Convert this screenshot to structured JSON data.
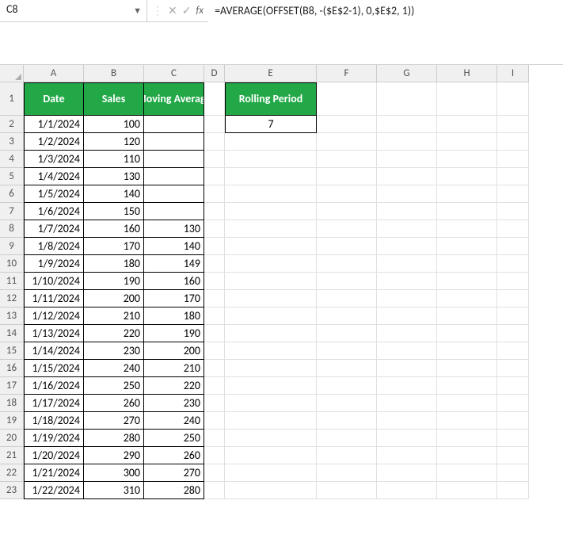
{
  "nameBox": "C8",
  "formula": "=AVERAGE(OFFSET(B8, -($E$2-1), 0,$E$2, 1))",
  "columns": [
    "A",
    "B",
    "C",
    "D",
    "E",
    "F",
    "G",
    "H",
    "I"
  ],
  "headers": {
    "date": "Date",
    "sales": "Sales",
    "mavg": "Moving Average",
    "period": "Rolling Period"
  },
  "periodValue": "7",
  "rows": [
    {
      "n": 2,
      "date": "1/1/2024",
      "sales": "100",
      "mavg": ""
    },
    {
      "n": 3,
      "date": "1/2/2024",
      "sales": "120",
      "mavg": ""
    },
    {
      "n": 4,
      "date": "1/3/2024",
      "sales": "110",
      "mavg": ""
    },
    {
      "n": 5,
      "date": "1/4/2024",
      "sales": "130",
      "mavg": ""
    },
    {
      "n": 6,
      "date": "1/5/2024",
      "sales": "140",
      "mavg": ""
    },
    {
      "n": 7,
      "date": "1/6/2024",
      "sales": "150",
      "mavg": ""
    },
    {
      "n": 8,
      "date": "1/7/2024",
      "sales": "160",
      "mavg": "130"
    },
    {
      "n": 9,
      "date": "1/8/2024",
      "sales": "170",
      "mavg": "140"
    },
    {
      "n": 10,
      "date": "1/9/2024",
      "sales": "180",
      "mavg": "149"
    },
    {
      "n": 11,
      "date": "1/10/2024",
      "sales": "190",
      "mavg": "160"
    },
    {
      "n": 12,
      "date": "1/11/2024",
      "sales": "200",
      "mavg": "170"
    },
    {
      "n": 13,
      "date": "1/12/2024",
      "sales": "210",
      "mavg": "180"
    },
    {
      "n": 14,
      "date": "1/13/2024",
      "sales": "220",
      "mavg": "190"
    },
    {
      "n": 15,
      "date": "1/14/2024",
      "sales": "230",
      "mavg": "200"
    },
    {
      "n": 16,
      "date": "1/15/2024",
      "sales": "240",
      "mavg": "210"
    },
    {
      "n": 17,
      "date": "1/16/2024",
      "sales": "250",
      "mavg": "220"
    },
    {
      "n": 18,
      "date": "1/17/2024",
      "sales": "260",
      "mavg": "230"
    },
    {
      "n": 19,
      "date": "1/18/2024",
      "sales": "270",
      "mavg": "240"
    },
    {
      "n": 20,
      "date": "1/19/2024",
      "sales": "280",
      "mavg": "250"
    },
    {
      "n": 21,
      "date": "1/20/2024",
      "sales": "290",
      "mavg": "260"
    },
    {
      "n": 22,
      "date": "1/21/2024",
      "sales": "300",
      "mavg": "270"
    },
    {
      "n": 23,
      "date": "1/22/2024",
      "sales": "310",
      "mavg": "280"
    }
  ]
}
